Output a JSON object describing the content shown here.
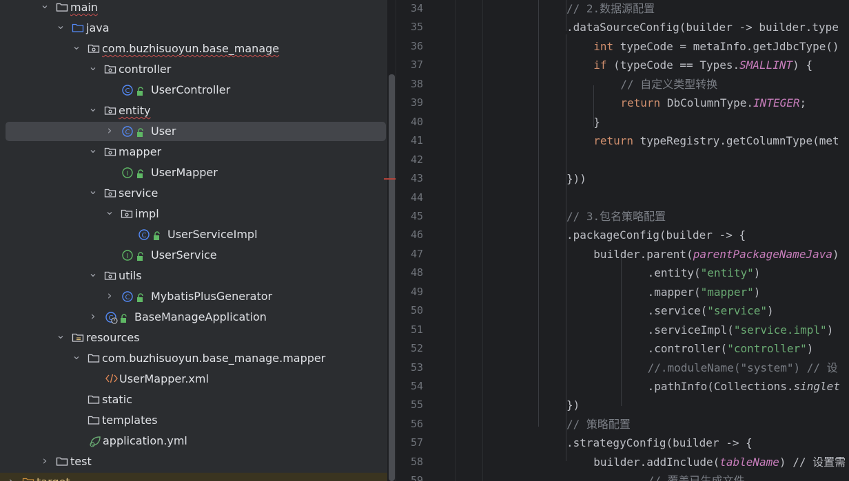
{
  "project_tree": {
    "items": [
      {
        "label": "main",
        "icon": "folder-icon",
        "expanded": true,
        "depth": 0
      },
      {
        "label": "java",
        "icon": "source-folder-icon",
        "expanded": true,
        "depth": 1
      },
      {
        "label": "com.buzhisuoyun.base_manage",
        "icon": "package-icon",
        "expanded": true,
        "depth": 2
      },
      {
        "label": "controller",
        "icon": "package-icon",
        "expanded": true,
        "depth": 3
      },
      {
        "label": "UserController",
        "icon": "class-icon",
        "depth": 4
      },
      {
        "label": "entity",
        "icon": "package-icon",
        "expanded": true,
        "depth": 3
      },
      {
        "label": "User",
        "icon": "class-icon",
        "expanded": false,
        "depth": 4,
        "selected": true
      },
      {
        "label": "mapper",
        "icon": "package-icon",
        "expanded": true,
        "depth": 3
      },
      {
        "label": "UserMapper",
        "icon": "interface-icon",
        "depth": 4
      },
      {
        "label": "service",
        "icon": "package-icon",
        "expanded": true,
        "depth": 3
      },
      {
        "label": "impl",
        "icon": "package-icon",
        "expanded": true,
        "depth": 4
      },
      {
        "label": "UserServiceImpl",
        "icon": "class-icon",
        "depth": 5
      },
      {
        "label": "UserService",
        "icon": "interface-icon",
        "depth": 4
      },
      {
        "label": "utils",
        "icon": "package-icon",
        "expanded": true,
        "depth": 3
      },
      {
        "label": "MybatisPlusGenerator",
        "icon": "class-icon",
        "expanded": false,
        "depth": 4
      },
      {
        "label": "BaseManageApplication",
        "icon": "spring-boot-class-icon",
        "expanded": false,
        "depth": 3
      },
      {
        "label": "resources",
        "icon": "resources-folder-icon",
        "expanded": true,
        "depth": 1
      },
      {
        "label": "com.buzhisuoyun.base_manage.mapper",
        "icon": "folder-icon",
        "expanded": true,
        "depth": 2
      },
      {
        "label": "UserMapper.xml",
        "icon": "xml-file-icon",
        "depth": 3
      },
      {
        "label": "static",
        "icon": "folder-icon",
        "depth": 2
      },
      {
        "label": "templates",
        "icon": "folder-icon",
        "depth": 2
      },
      {
        "label": "application.yml",
        "icon": "yaml-file-icon",
        "depth": 2
      },
      {
        "label": "test",
        "icon": "folder-icon",
        "expanded": false,
        "depth": 0
      },
      {
        "label": "target",
        "icon": "excluded-folder-icon",
        "expanded": false,
        "depth": -1
      }
    ]
  },
  "editor": {
    "lines": [
      {
        "n": "34",
        "tokens": [
          {
            "t": "// 2.数据源配置",
            "c": "cm"
          }
        ]
      },
      {
        "n": "35",
        "tokens": [
          {
            "t": ".dataSourceConfig(builder -> builder.type",
            "c": ""
          }
        ]
      },
      {
        "n": "36",
        "tokens": [
          {
            "t": "int",
            "c": "kw"
          },
          {
            "t": " typeCode = metaInfo.getJdbcType()",
            "c": ""
          }
        ]
      },
      {
        "n": "37",
        "tokens": [
          {
            "t": "if",
            "c": "kw"
          },
          {
            "t": " (typeCode == Types.",
            "c": ""
          },
          {
            "t": "SMALLINT",
            "c": "it"
          },
          {
            "t": ") {",
            "c": ""
          }
        ]
      },
      {
        "n": "38",
        "tokens": [
          {
            "t": "// 自定义类型转换",
            "c": "cm"
          }
        ]
      },
      {
        "n": "39",
        "tokens": [
          {
            "t": "return",
            "c": "kw"
          },
          {
            "t": " DbColumnType.",
            "c": ""
          },
          {
            "t": "INTEGER",
            "c": "it"
          },
          {
            "t": ";",
            "c": ""
          }
        ]
      },
      {
        "n": "40",
        "tokens": [
          {
            "t": "}",
            "c": ""
          }
        ]
      },
      {
        "n": "41",
        "tokens": [
          {
            "t": "return",
            "c": "kw"
          },
          {
            "t": " typeRegistry.getColumnType(met",
            "c": ""
          }
        ]
      },
      {
        "n": "42",
        "tokens": []
      },
      {
        "n": "43",
        "tokens": [
          {
            "t": "}))",
            "c": ""
          }
        ]
      },
      {
        "n": "44",
        "tokens": []
      },
      {
        "n": "45",
        "tokens": [
          {
            "t": "// 3.包名策略配置",
            "c": "cm"
          }
        ]
      },
      {
        "n": "46",
        "tokens": [
          {
            "t": ".packageConfig(builder -> {",
            "c": ""
          }
        ]
      },
      {
        "n": "47",
        "tokens": [
          {
            "t": "builder.parent(",
            "c": ""
          },
          {
            "t": "parentPackageNameJava",
            "c": "it"
          },
          {
            "t": ")",
            "c": ""
          }
        ]
      },
      {
        "n": "48",
        "tokens": [
          {
            "t": ".entity(",
            "c": ""
          },
          {
            "t": "\"entity\"",
            "c": "st"
          },
          {
            "t": ")",
            "c": ""
          }
        ]
      },
      {
        "n": "49",
        "tokens": [
          {
            "t": ".mapper(",
            "c": ""
          },
          {
            "t": "\"mapper\"",
            "c": "st"
          },
          {
            "t": ")",
            "c": ""
          }
        ]
      },
      {
        "n": "50",
        "tokens": [
          {
            "t": ".service(",
            "c": ""
          },
          {
            "t": "\"service\"",
            "c": "st"
          },
          {
            "t": ")",
            "c": ""
          }
        ]
      },
      {
        "n": "51",
        "tokens": [
          {
            "t": ".serviceImpl(",
            "c": ""
          },
          {
            "t": "\"service.impl\"",
            "c": "st"
          },
          {
            "t": ")",
            "c": ""
          }
        ]
      },
      {
        "n": "52",
        "tokens": [
          {
            "t": ".controller(",
            "c": ""
          },
          {
            "t": "\"controller\"",
            "c": "st"
          },
          {
            "t": ")",
            "c": ""
          }
        ]
      },
      {
        "n": "53",
        "tokens": [
          {
            "t": "//.moduleName(\"system\") // 设",
            "c": "cm"
          }
        ]
      },
      {
        "n": "54",
        "tokens": [
          {
            "t": ".pathInfo(Collections.",
            "c": ""
          },
          {
            "t": "singlet",
            "c": "ital"
          }
        ]
      },
      {
        "n": "55",
        "tokens": [
          {
            "t": "})",
            "c": ""
          }
        ]
      },
      {
        "n": "56",
        "tokens": [
          {
            "t": "// 策略配置",
            "c": "cm"
          }
        ]
      },
      {
        "n": "57",
        "tokens": [
          {
            "t": ".strategyConfig(builder -> {",
            "c": ""
          }
        ]
      },
      {
        "n": "58",
        "tokens": [
          {
            "t": "builder.addInclude(",
            "c": ""
          },
          {
            "t": "tableName",
            "c": "it"
          },
          {
            "t": ") // 设置需",
            "c": ""
          }
        ]
      },
      {
        "n": "59",
        "tokens": [
          {
            "t": "// 覆盖已生成文件",
            "c": "cm"
          }
        ]
      }
    ]
  },
  "colors": {
    "tree_bg": "#2b2d30",
    "editor_bg": "#1e1f22",
    "selected_row": "#43454a",
    "keyword": "#cf8e6d",
    "string": "#6aab73",
    "comment": "#7a7e85",
    "constant": "#c77dbb"
  }
}
